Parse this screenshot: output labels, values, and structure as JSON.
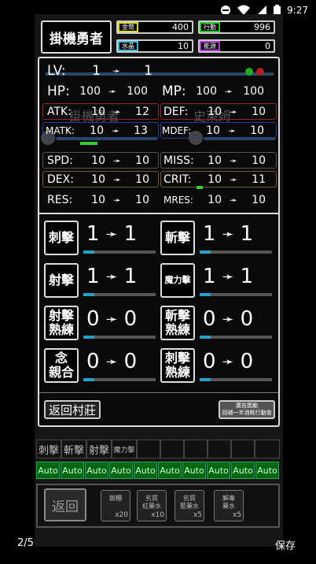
{
  "status": {
    "time": "9:27"
  },
  "header": {
    "title": "掛機勇者",
    "gold_label": "金幣",
    "gold": "400",
    "action_label": "行動",
    "action": "996",
    "crystal_label": "水晶",
    "crystal": "10",
    "energy_label": "能源",
    "energy": "0"
  },
  "stats": {
    "lv": {
      "label": "LV:",
      "from": "1",
      "to": "1"
    },
    "hp": {
      "label": "HP:",
      "from": "100",
      "to": "100"
    },
    "mp": {
      "label": "MP:",
      "from": "100",
      "to": "100"
    },
    "atk": {
      "label": "ATK:",
      "from": "10",
      "to": "12"
    },
    "def": {
      "label": "DEF:",
      "from": "10",
      "to": "10"
    },
    "matk": {
      "label": "MATK:",
      "from": "10",
      "to": "13"
    },
    "mdef": {
      "label": "MDEF:",
      "from": "10",
      "to": "10"
    },
    "spd": {
      "label": "SPD:",
      "from": "10",
      "to": "10"
    },
    "miss": {
      "label": "MISS:",
      "from": "10",
      "to": "10"
    },
    "dex": {
      "label": "DEX:",
      "from": "10",
      "to": "10"
    },
    "crit": {
      "label": "CRIT:",
      "from": "10",
      "to": "11"
    },
    "res": {
      "label": "RES:",
      "from": "10",
      "to": "10"
    },
    "mres": {
      "label": "MRES:",
      "from": "10",
      "to": "10"
    },
    "arrow": "➛",
    "ghost_hero": "掛機勇者",
    "ghost_enemy": "史萊姆"
  },
  "skills": [
    {
      "name": "刺擊",
      "from": "1",
      "to": "1"
    },
    {
      "name": "斬擊",
      "from": "1",
      "to": "1"
    },
    {
      "name": "射擊",
      "from": "1",
      "to": "1"
    },
    {
      "name": "魔力擊",
      "from": "1",
      "to": "1"
    },
    {
      "name": "射擊\n熟練",
      "from": "0",
      "to": "0"
    },
    {
      "name": "斬擊\n熟練",
      "from": "0",
      "to": "0"
    },
    {
      "name": "念\n親合",
      "from": "0",
      "to": "0"
    },
    {
      "name": "刺擊\n熟練",
      "from": "0",
      "to": "0"
    }
  ],
  "buttons": {
    "return_village": "返回村莊",
    "ad_watch": "廣告獎勵\n回補一半消耗行動值",
    "back": "返回"
  },
  "tabs": [
    "刺擊",
    "斬擊",
    "射擊",
    "魔力擊"
  ],
  "auto_label": "Auto",
  "items": [
    {
      "name": "飯糰",
      "qty": "x20"
    },
    {
      "name": "劣質\n紅藥水",
      "qty": "x10"
    },
    {
      "name": "劣質\n藍藥水",
      "qty": "x5"
    },
    {
      "name": "解毒\n藥水",
      "qty": "x5"
    }
  ],
  "footer": {
    "page": "2/5",
    "save": "保存"
  }
}
